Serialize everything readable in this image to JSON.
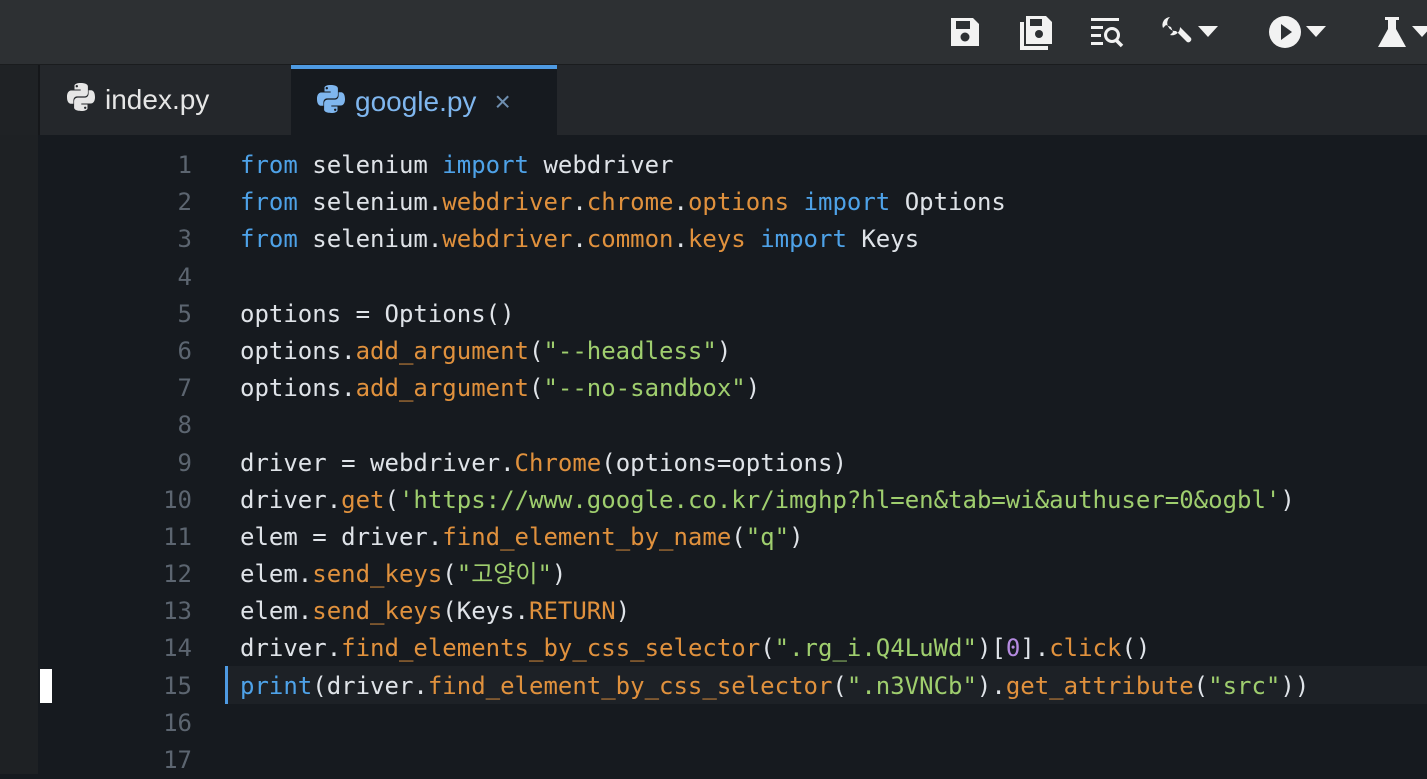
{
  "toolbar": {
    "buttons": [
      {
        "name": "save-icon"
      },
      {
        "name": "save-all-icon"
      },
      {
        "name": "find-in-files-icon"
      },
      {
        "name": "wrench-icon",
        "dropdown": true
      },
      {
        "name": "run-icon",
        "dropdown": true
      },
      {
        "name": "flask-icon",
        "dropdown": true
      }
    ]
  },
  "tabs": [
    {
      "label": "index.py",
      "active": false
    },
    {
      "label": "google.py",
      "active": true,
      "close": "×"
    }
  ],
  "editor": {
    "current_line": 15,
    "lines": [
      {
        "n": "1",
        "tokens": [
          [
            "kw",
            "from"
          ],
          [
            "p",
            " selenium "
          ],
          [
            "kw",
            "import"
          ],
          [
            "p",
            " webdriver"
          ]
        ]
      },
      {
        "n": "2",
        "tokens": [
          [
            "kw",
            "from"
          ],
          [
            "p",
            " selenium."
          ],
          [
            "fn",
            "webdriver"
          ],
          [
            "p",
            "."
          ],
          [
            "fn",
            "chrome"
          ],
          [
            "p",
            "."
          ],
          [
            "fn",
            "options"
          ],
          [
            "p",
            " "
          ],
          [
            "kw",
            "import"
          ],
          [
            "p",
            " Options"
          ]
        ]
      },
      {
        "n": "3",
        "tokens": [
          [
            "kw",
            "from"
          ],
          [
            "p",
            " selenium."
          ],
          [
            "fn",
            "webdriver"
          ],
          [
            "p",
            "."
          ],
          [
            "fn",
            "common"
          ],
          [
            "p",
            "."
          ],
          [
            "fn",
            "keys"
          ],
          [
            "p",
            " "
          ],
          [
            "kw",
            "import"
          ],
          [
            "p",
            " Keys"
          ]
        ]
      },
      {
        "n": "4",
        "tokens": []
      },
      {
        "n": "5",
        "tokens": [
          [
            "p",
            "options = Options()"
          ]
        ]
      },
      {
        "n": "6",
        "tokens": [
          [
            "p",
            "options."
          ],
          [
            "fn",
            "add_argument"
          ],
          [
            "p",
            "("
          ],
          [
            "str",
            "\"--headless\""
          ],
          [
            "p",
            ")"
          ]
        ]
      },
      {
        "n": "7",
        "tokens": [
          [
            "p",
            "options."
          ],
          [
            "fn",
            "add_argument"
          ],
          [
            "p",
            "("
          ],
          [
            "str",
            "\"--no-sandbox\""
          ],
          [
            "p",
            ")"
          ]
        ]
      },
      {
        "n": "8",
        "tokens": []
      },
      {
        "n": "9",
        "tokens": [
          [
            "p",
            "driver = webdriver."
          ],
          [
            "fn",
            "Chrome"
          ],
          [
            "p",
            "(options=options)"
          ]
        ]
      },
      {
        "n": "10",
        "tokens": [
          [
            "p",
            "driver."
          ],
          [
            "fn",
            "get"
          ],
          [
            "p",
            "("
          ],
          [
            "str",
            "'https://www.google.co.kr/imghp?hl=en&tab=wi&authuser=0&ogbl'"
          ],
          [
            "p",
            ")"
          ]
        ]
      },
      {
        "n": "11",
        "tokens": [
          [
            "p",
            "elem = driver."
          ],
          [
            "fn",
            "find_element_by_name"
          ],
          [
            "p",
            "("
          ],
          [
            "str",
            "\"q\""
          ],
          [
            "p",
            ")"
          ]
        ]
      },
      {
        "n": "12",
        "tokens": [
          [
            "p",
            "elem."
          ],
          [
            "fn",
            "send_keys"
          ],
          [
            "p",
            "("
          ],
          [
            "str",
            "\"고양이\""
          ],
          [
            "p",
            ")"
          ]
        ]
      },
      {
        "n": "13",
        "tokens": [
          [
            "p",
            "elem."
          ],
          [
            "fn",
            "send_keys"
          ],
          [
            "p",
            "(Keys."
          ],
          [
            "fn",
            "RETURN"
          ],
          [
            "p",
            ")"
          ]
        ]
      },
      {
        "n": "14",
        "tokens": [
          [
            "p",
            "driver."
          ],
          [
            "fn",
            "find_elements_by_css_selector"
          ],
          [
            "p",
            "("
          ],
          [
            "str",
            "\".rg_i.Q4LuWd\""
          ],
          [
            "p",
            ")["
          ],
          [
            "num",
            "0"
          ],
          [
            "p",
            "]."
          ],
          [
            "fn",
            "click"
          ],
          [
            "p",
            "()"
          ]
        ]
      },
      {
        "n": "15",
        "tokens": [
          [
            "kw",
            "print"
          ],
          [
            "p",
            "(driver."
          ],
          [
            "fn",
            "find_element_by_css_selector"
          ],
          [
            "p",
            "("
          ],
          [
            "str",
            "\".n3VNCb\""
          ],
          [
            "p",
            ")."
          ],
          [
            "fn",
            "get_attribute"
          ],
          [
            "p",
            "("
          ],
          [
            "str",
            "\"src\""
          ],
          [
            "p",
            "))"
          ]
        ]
      },
      {
        "n": "16",
        "tokens": []
      },
      {
        "n": "17",
        "tokens": []
      }
    ]
  },
  "colors": {
    "keyword": "#4ea2e8",
    "function": "#e0913d",
    "string": "#9fce6e",
    "number": "#b58ae0",
    "accent": "#4e9ae2"
  }
}
